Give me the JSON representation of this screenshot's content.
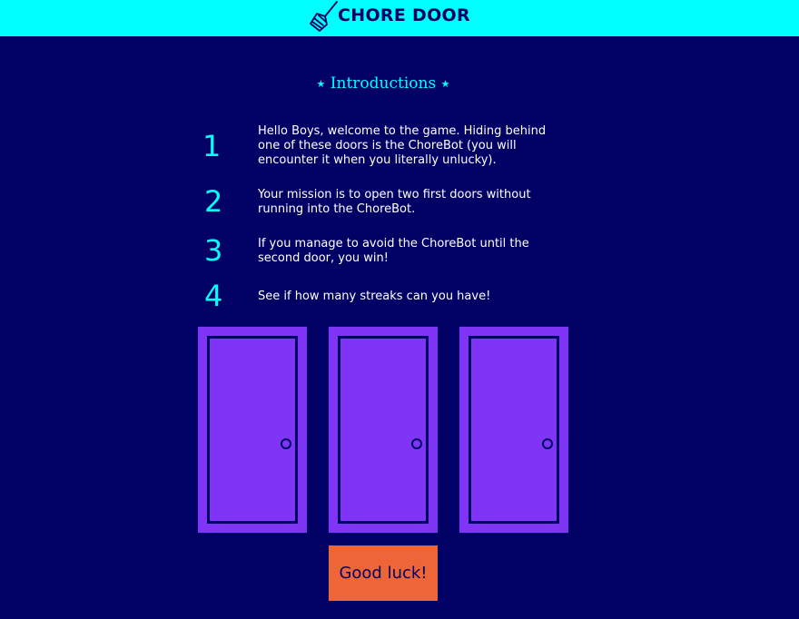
{
  "header": {
    "logo_icon": "broom-icon",
    "title": "CHORE DOOR",
    "background_color": "#00ffff"
  },
  "instructions": {
    "title": "Introductions",
    "star_icon": "star-icon",
    "steps": [
      {
        "number": "1",
        "text": "Hello Boys, welcome to the game. Hiding behind one of these doors is the ChoreBot (you will encounter it when you literally unlucky)."
      },
      {
        "number": "2",
        "text": "Your mission is to open two first doors without running into the ChoreBot."
      },
      {
        "number": "3",
        "text": "If you manage to avoid the ChoreBot until the second door, you win!"
      },
      {
        "number": "4",
        "text": "See if how many streaks can you have!"
      }
    ]
  },
  "doors": [
    {
      "name": "door-1",
      "state": "closed"
    },
    {
      "name": "door-2",
      "state": "closed"
    },
    {
      "name": "door-3",
      "state": "closed"
    }
  ],
  "start_button": {
    "label": "Good luck!"
  },
  "colors": {
    "page_background": "#010165",
    "accent": "#00ffff",
    "door": "#8035f6",
    "button": "#ee6637",
    "text": "#ffffff"
  }
}
